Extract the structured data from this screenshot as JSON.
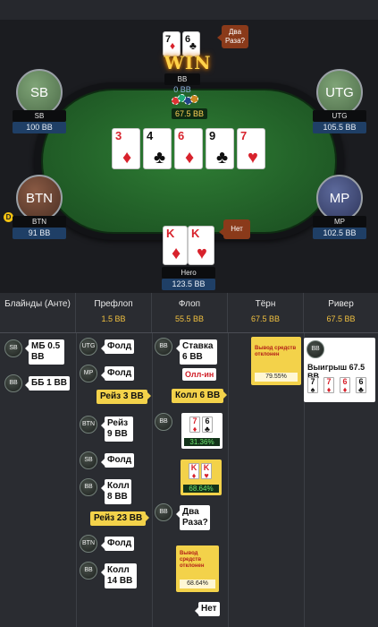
{
  "table": {
    "seats": {
      "bb": {
        "name": "BB",
        "stack": "0 BB"
      },
      "sb": {
        "avatar": "SB",
        "name": "SB",
        "stack": "100 BB"
      },
      "utg": {
        "avatar": "UTG",
        "name": "UTG",
        "stack": "105.5 BB"
      },
      "btn": {
        "avatar": "BTN",
        "name": "BTN",
        "stack": "91 BB"
      },
      "mp": {
        "avatar": "MP",
        "name": "MP",
        "stack": "102.5 BB"
      },
      "hero": {
        "name": "Hero",
        "stack": "123.5 BB"
      }
    },
    "bb_speech": "Два Раза?",
    "hero_speech": "Нет",
    "win_label": "WIN",
    "pot": "67.5 BB",
    "dealer": "D",
    "bb_cards": [
      {
        "rank": "7",
        "suit": "♦"
      },
      {
        "rank": "6",
        "suit": "♣"
      }
    ],
    "hero_cards": [
      {
        "rank": "K",
        "suit": "♦"
      },
      {
        "rank": "K",
        "suit": "♥"
      }
    ],
    "board": [
      {
        "rank": "3",
        "suit": "♦"
      },
      {
        "rank": "4",
        "suit": "♣"
      },
      {
        "rank": "6",
        "suit": "♦"
      },
      {
        "rank": "9",
        "suit": "♣"
      },
      {
        "rank": "7",
        "suit": "♥"
      }
    ],
    "colors": {
      "felt": "#2f7f35",
      "pot_text": "#ffd257",
      "stack_bg": "#1f3f66"
    }
  },
  "history": {
    "columns": [
      {
        "title": "Блайнды (Анте)",
        "pot": ""
      },
      {
        "title": "Префлоп",
        "pot": "1.5 BB"
      },
      {
        "title": "Флоп",
        "pot": "55.5 BB"
      },
      {
        "title": "Тёрн",
        "pot": "67.5 BB"
      },
      {
        "title": "Ривер",
        "pot": "67.5 BB"
      }
    ],
    "blinds": [
      {
        "pos": "SB",
        "text": "МБ 0.5 BB"
      },
      {
        "pos": "BB",
        "text": "ББ 1 BB"
      }
    ],
    "preflop": {
      "utg": {
        "pos": "UTG",
        "text": "Фолд"
      },
      "mp": {
        "pos": "MP",
        "text": "Фолд"
      },
      "hero_raise": "Рейз 3 BB",
      "btn_raise": {
        "pos": "BTN",
        "text": "Рейз 9 BB"
      },
      "sb_fold": {
        "pos": "SB",
        "text": "Фолд"
      },
      "bb_call": {
        "pos": "BB",
        "text": "Колл 8 BB"
      },
      "hero_raise2": "Рейз 23 BB",
      "btn_fold": {
        "pos": "BTN",
        "text": "Фолд"
      },
      "bb_call2": {
        "pos": "BB",
        "text": "Колл 14 BB"
      }
    },
    "flop": {
      "bb_bet": {
        "pos": "BB",
        "text": "Ставка 6 BB"
      },
      "allin": "Олл-ин",
      "hero_call": "Колл 6 BB",
      "bb_show": {
        "pos": "BB",
        "cards": [
          {
            "rank": "7",
            "suit": "♦"
          },
          {
            "rank": "6",
            "suit": "♣"
          }
        ],
        "pct": "31.36%"
      },
      "hero_show": {
        "cards": [
          {
            "rank": "K",
            "suit": "♦"
          },
          {
            "rank": "K",
            "suit": "♥"
          }
        ],
        "pct": "68.64%"
      },
      "bb_ask": {
        "pos": "BB",
        "text": "Два Раза?"
      },
      "ev_note": {
        "text": "Вывод средств отклонен",
        "pct": "68.64%"
      },
      "hero_no": "Нет"
    },
    "turn": {
      "ev_note": {
        "text": "Вывод средств отклонен",
        "pct": "79.55%"
      }
    },
    "river": {
      "winner_pos": "BB",
      "win_text": "Выигрыш 67.5 BB",
      "cards": [
        {
          "rank": "7",
          "suit": "♠"
        },
        {
          "rank": "7",
          "suit": "♦"
        },
        {
          "rank": "6",
          "suit": "♦"
        },
        {
          "rank": "6",
          "suit": "♣"
        }
      ]
    }
  }
}
